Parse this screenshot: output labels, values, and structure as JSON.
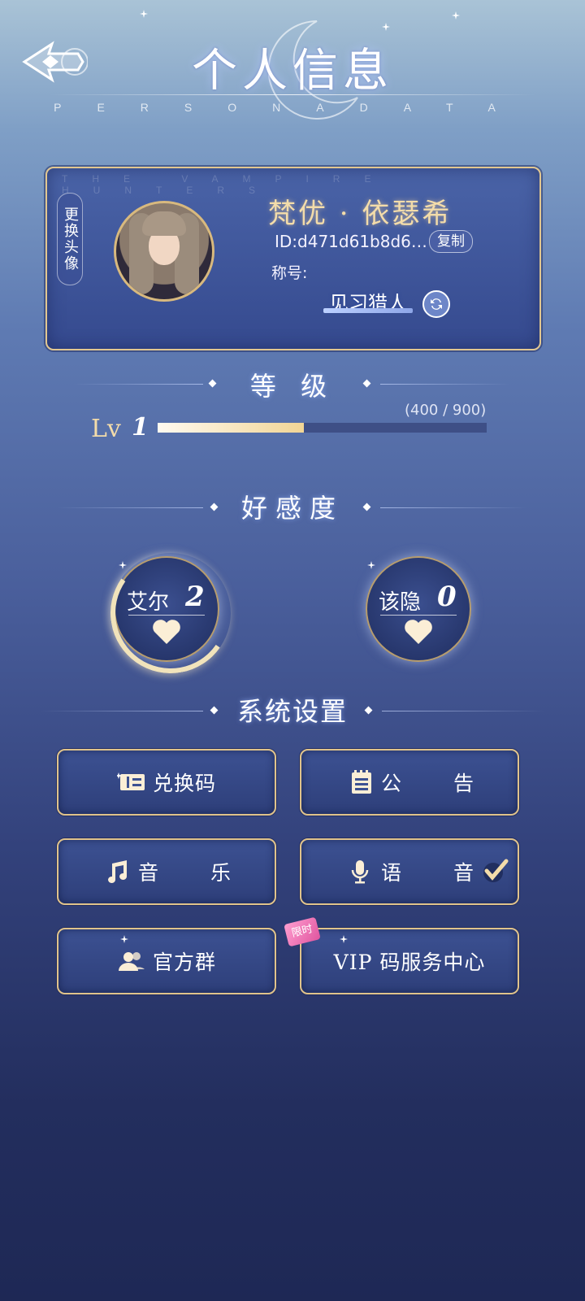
{
  "header": {
    "title": "个人信息",
    "subtitle": "PERSONADATA"
  },
  "profile": {
    "watermark": "THE VAMPIRE HUNTERS",
    "change_avatar_label": "更换头像",
    "name": "梵优 · 依瑟希",
    "id": "ID:d471d61b8d6…",
    "copy_label": "复制",
    "title_label": "称号:",
    "title_badge": "见习猎人"
  },
  "level": {
    "heading": "等 级",
    "lv_label": "Lv",
    "lv_value": "1",
    "exp_text": "(400 / 900)",
    "exp_current": 400,
    "exp_max": 900
  },
  "affection": {
    "heading": "好感度",
    "characters": [
      {
        "name": "艾尔",
        "value": "2"
      },
      {
        "name": "该隐",
        "value": "0"
      }
    ]
  },
  "settings": {
    "heading": "系统设置",
    "buttons": {
      "redeem": "兑换码",
      "notice": "公 告",
      "music": "音 乐",
      "voice": "语 音",
      "official_group": "官方群",
      "vip": "VIP 码服务中心"
    },
    "limited_tag": "限时"
  },
  "colors": {
    "gold": "#e0c38b",
    "accent_text": "#f3dcaa",
    "panel": "#3c5192"
  }
}
